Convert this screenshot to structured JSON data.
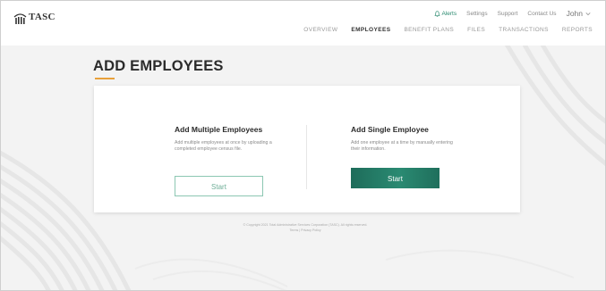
{
  "header": {
    "logo_text": "TASC",
    "utility": {
      "alerts": "Alerts",
      "settings": "Settings",
      "support": "Support",
      "contact": "Contact Us",
      "user": "John"
    },
    "nav": [
      "OVERVIEW",
      "EMPLOYEES",
      "BENEFIT PLANS",
      "FILES",
      "TRANSACTIONS",
      "REPORTS"
    ],
    "active_nav": "EMPLOYEES"
  },
  "page": {
    "title": "ADD EMPLOYEES"
  },
  "card": {
    "multiple": {
      "title": "Add Multiple Employees",
      "description": "Add multiple employees at once by uploading a completed employee census file.",
      "button": "Start"
    },
    "single": {
      "title": "Add Single Employee",
      "description": "Add one employee at a time by manually entering their information.",
      "button": "Start"
    }
  },
  "footer": {
    "copyright": "© Copyright 2021 Total Administrative Services Corporation (TASC). All rights reserved.",
    "link": "Terms | Privacy Policy"
  },
  "colors": {
    "accent_green": "#1e6c5a",
    "outline_green": "#8cc7b2",
    "title_underline": "#e8a13a"
  },
  "icons": {
    "logo": "tasc-logo-icon",
    "alerts": "bell-icon",
    "user_menu": "chevron-down-icon"
  }
}
